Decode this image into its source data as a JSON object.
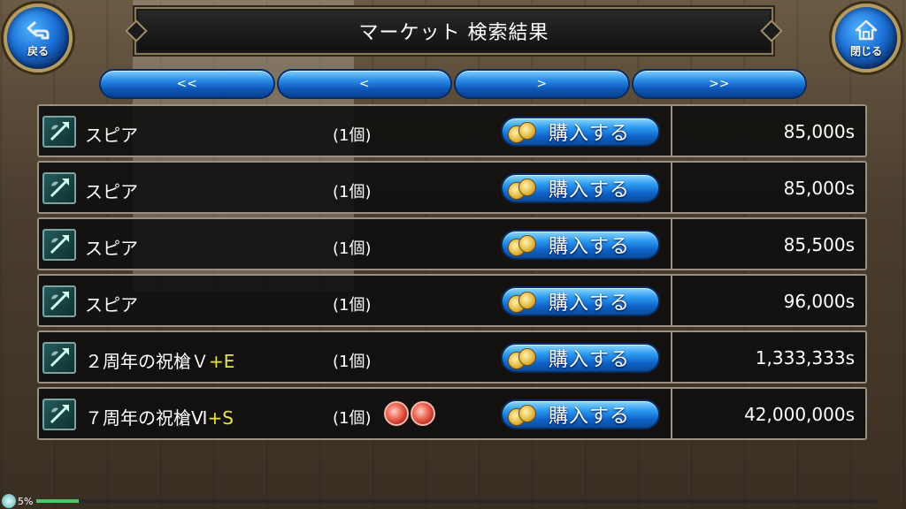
{
  "header": {
    "title": "マーケット 検索結果",
    "back_label": "戻る",
    "close_label": "閉じる"
  },
  "pager": {
    "first": "<<",
    "prev": "<",
    "next": ">",
    "last": ">>"
  },
  "buy_label": "購入する",
  "rows": [
    {
      "name": "スピア",
      "enh": "",
      "qty": "(1個)",
      "price": "85,000s",
      "gems": 0
    },
    {
      "name": "スピア",
      "enh": "",
      "qty": "(1個)",
      "price": "85,000s",
      "gems": 0
    },
    {
      "name": "スピア",
      "enh": "",
      "qty": "(1個)",
      "price": "85,500s",
      "gems": 0
    },
    {
      "name": "スピア",
      "enh": "",
      "qty": "(1個)",
      "price": "96,000s",
      "gems": 0
    },
    {
      "name": "２周年の祝槍Ｖ",
      "enh": "+E",
      "qty": "(1個)",
      "price": "1,333,333s",
      "gems": 0
    },
    {
      "name": "７周年の祝槍Ⅵ",
      "enh": "+S",
      "qty": "(1個)",
      "price": "42,000,000s",
      "gems": 2
    }
  ],
  "status": {
    "text": "5%",
    "progress": 0.05
  },
  "colors": {
    "accent_blue": "#2c8de8",
    "enh_yellow": "#e8e63a",
    "gold_frame": "#b49a5e"
  }
}
